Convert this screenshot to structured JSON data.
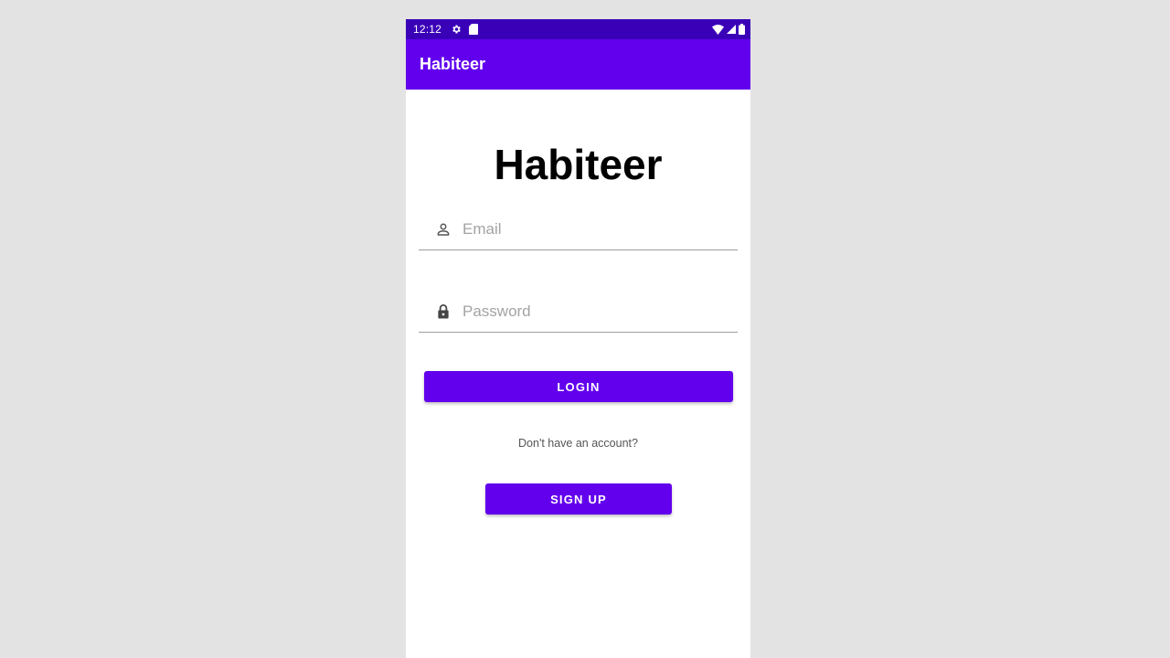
{
  "status_bar": {
    "time": "12:12",
    "left_icons": [
      "settings-icon",
      "sd-card-icon"
    ],
    "right_icons": [
      "wifi-icon",
      "signal-icon",
      "battery-icon"
    ],
    "background": "#3a00b8"
  },
  "app_bar": {
    "title": "Habiteer",
    "background": "#6200ee"
  },
  "main": {
    "heading": "Habiteer",
    "email_field": {
      "icon": "person-icon",
      "placeholder": "Email",
      "value": ""
    },
    "password_field": {
      "icon": "lock-icon",
      "placeholder": "Password",
      "value": ""
    },
    "login_label": "LOGIN",
    "account_prompt": "Don't have an account?",
    "signup_label": "SIGN UP"
  },
  "colors": {
    "primary": "#6200ee",
    "primary_dark": "#3a00b8",
    "background": "#e3e3e3"
  }
}
